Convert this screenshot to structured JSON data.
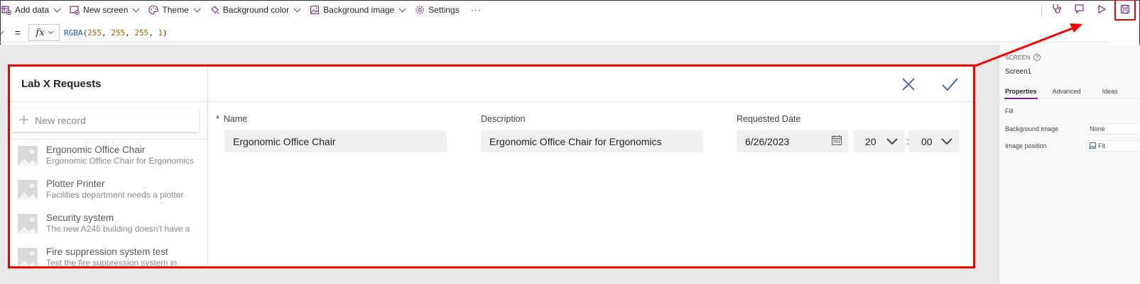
{
  "toolbar": {
    "add_data": "Add data",
    "new_screen": "New screen",
    "theme": "Theme",
    "background_color": "Background color",
    "background_image": "Background image",
    "settings": "Settings",
    "more": "···"
  },
  "formula": {
    "equals": "=",
    "fx": "fx",
    "fn_name": "RGBA",
    "open": "(",
    "r": "255",
    "g": "255",
    "b": "255",
    "a": "1",
    "sep": ", ",
    "close": ")"
  },
  "app": {
    "title": "Lab X Requests",
    "new_record": "New record",
    "items": [
      {
        "title": "Ergonomic Office Chair",
        "subtitle": "Ergonomic Office Chair for Ergonomics"
      },
      {
        "title": "Plotter Printer",
        "subtitle": "Facilities department needs a plotter"
      },
      {
        "title": "Security system",
        "subtitle": "The new A245 building doesn't have a"
      },
      {
        "title": "Fire suppression system test",
        "subtitle": "Test the fire suppression system in"
      }
    ],
    "form": {
      "required_marker": "*",
      "name_label": "Name",
      "name_value": "Ergonomic Office Chair",
      "description_label": "Description",
      "description_value": "Ergonomic Office Chair for Ergonomics",
      "date_label": "Requested Date",
      "date_value": "6/26/2023",
      "hour_value": "20",
      "time_colon": ":",
      "minute_value": "00"
    }
  },
  "panel": {
    "screen_label": "SCREEN",
    "help": "?",
    "screen_name": "Screen1",
    "tabs": [
      "Properties",
      "Advanced",
      "Ideas"
    ],
    "fill_label": "Fill",
    "bg_image_label": "Background image",
    "bg_image_value": "None",
    "image_pos_label": "Image position",
    "image_pos_value": "Fit"
  },
  "colors": {
    "accent": "#742774",
    "highlight": "#ee0000"
  }
}
